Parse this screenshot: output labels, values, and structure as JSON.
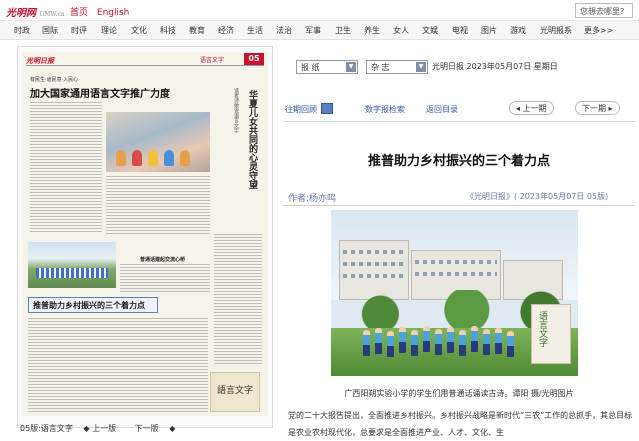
{
  "header": {
    "logo_text": "光明网",
    "logo_sub": "GMW.cn",
    "links": [
      "首页",
      "English"
    ],
    "search_placeholder": "您想去哪里?"
  },
  "nav": {
    "items": [
      "时政",
      "国际",
      "时评",
      "理论",
      "文化",
      "科技",
      "教育",
      "经济",
      "生活",
      "法治",
      "军事",
      "卫生",
      "养生",
      "女人",
      "文娱",
      "电视",
      "图片",
      "游戏",
      "光明报系",
      "更多>>"
    ]
  },
  "selectors": {
    "newspaper": "报 纸",
    "magazine": "杂 志",
    "date_info": "光明日报 2023年05月07日 星期日"
  },
  "toolbar": {
    "past_review": "往期回顾",
    "digital_search": "数字报检索",
    "back_to_index": "返回目录",
    "prev_page": "上一期",
    "next_page": "下一期"
  },
  "newspaper_page": {
    "masthead": "光明日报",
    "column_name": "语言文字",
    "page_number": "05",
    "kicker": "有民生·道民意·入民心",
    "headline": "加大国家通用语言文字推广力度",
    "vertical_title": "华夏儿女共同的心灵守望",
    "vertical_sub": "读者诗歌说语言文字",
    "subhead2": "普通话建起交流心桥",
    "boxed_headline": "推普助力乡村振兴的三个着力点",
    "calligraphy": "語言文字"
  },
  "pager": {
    "current": "05版:语言文字",
    "prev": "上一版",
    "next": "下一版"
  },
  "article": {
    "title": "推普助力乡村振兴的三个着力点",
    "byline": "作者:杨亦鸣",
    "source": "《光明日报》( 2023年05月07日  05版)",
    "photo_sign": "语言文字",
    "caption": "广西阳朔实验小学的学生们用普通话诵读古诗。谭阳  摄/光明图片",
    "body": "党的二十大报告提出，全面推进乡村振兴。乡村振兴战略是新时代“三农”工作的总抓手，其总目标是农业农村现代化，总要求是全面推进产业、人才、文化、生"
  }
}
